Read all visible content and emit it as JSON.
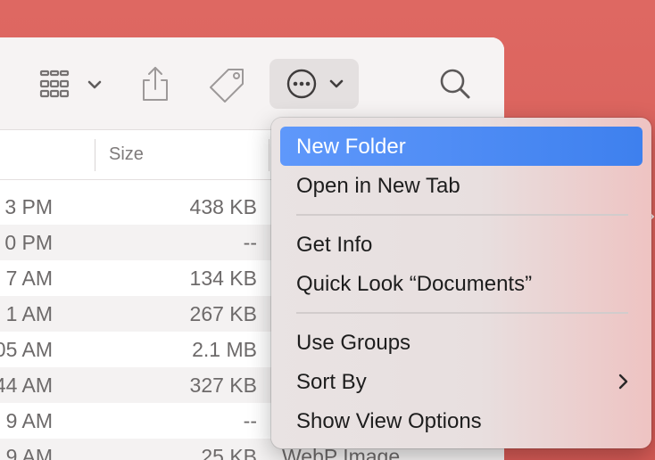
{
  "toolbar": {
    "icons": [
      "view-grid-icon",
      "chevron-down-icon",
      "share-icon",
      "tag-icon",
      "more-actions-icon",
      "search-icon"
    ]
  },
  "list": {
    "columns": [
      "Size"
    ],
    "rows": [
      {
        "date": "3 PM",
        "size": "438 KB",
        "kind": ""
      },
      {
        "date": "0 PM",
        "size": "--",
        "kind": ""
      },
      {
        "date": "7 AM",
        "size": "134 KB",
        "kind": ""
      },
      {
        "date": "1 AM",
        "size": "267 KB",
        "kind": ""
      },
      {
        "date": "05 AM",
        "size": "2.1 MB",
        "kind": ""
      },
      {
        "date": "44 AM",
        "size": "327 KB",
        "kind": ""
      },
      {
        "date": "9 AM",
        "size": "--",
        "kind": ""
      },
      {
        "date": "9 AM",
        "size": "25 KB",
        "kind": "WebP Image"
      }
    ]
  },
  "menu": {
    "items": [
      {
        "label": "New Folder",
        "selected": true
      },
      {
        "label": "Open in New Tab"
      },
      {
        "label": "Get Info"
      },
      {
        "label": "Quick Look “Documents”"
      },
      {
        "label": "Use Groups"
      },
      {
        "label": "Sort By",
        "submenu": true
      },
      {
        "label": "Show View Options"
      }
    ]
  },
  "colors": {
    "desktop": "#d9615c",
    "selection": "#4a8af4",
    "toolbar": "#f6f3f3"
  }
}
